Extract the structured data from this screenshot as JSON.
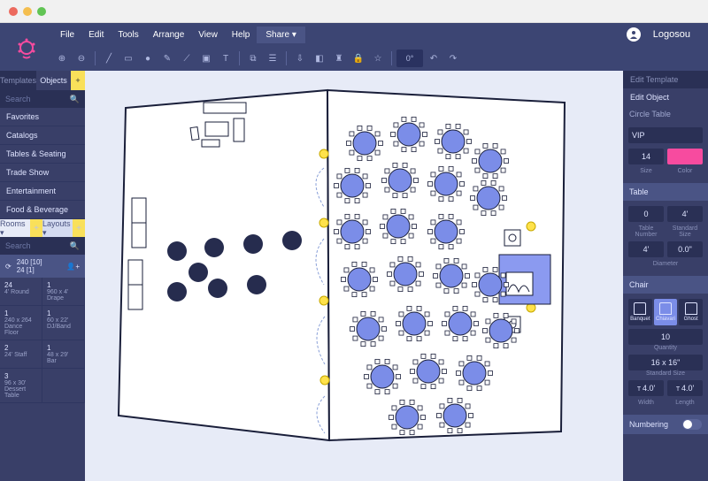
{
  "menubar": {
    "file": "File",
    "edit": "Edit",
    "tools": "Tools",
    "arrange": "Arrange",
    "view": "View",
    "help": "Help",
    "share": "Share ▾"
  },
  "user": {
    "name": "Logosou"
  },
  "toolbar": {
    "rotation": "0°"
  },
  "left": {
    "tabs": {
      "templates": "Templates",
      "objects": "Objects"
    },
    "search": "Search",
    "cats": [
      "Favorites",
      "Catalogs",
      "Tables & Seating",
      "Trade Show",
      "Entertainment",
      "Food & Beverage"
    ],
    "rooms": "Rooms ▾",
    "layouts": "Layouts ▾",
    "stats": {
      "a": "240 [10]",
      "b": "24 [1]"
    },
    "objs": [
      {
        "n": "24",
        "d": "4' Round"
      },
      {
        "n": "1",
        "d": "960 x 4' Drape"
      },
      {
        "n": "1",
        "d": "240 x 264 Dance Floor"
      },
      {
        "n": "1",
        "d": "60 x 22' DJ/Band"
      },
      {
        "n": "2",
        "d": "24' Staff"
      },
      {
        "n": "1",
        "d": "48 x 29' Bar"
      },
      {
        "n": "3",
        "d": "96 x 30' Dessert Table"
      },
      {
        "n": "",
        "d": ""
      }
    ]
  },
  "right": {
    "editTemplate": "Edit Template",
    "editObject": "Edit Object",
    "objType": "Circle Table",
    "name": "VIP",
    "size": "14",
    "sizeLbl": "Size",
    "colorLbl": "Color",
    "tableSec": "Table",
    "tableNum": "0",
    "tableNumLbl": "Table Number",
    "stdSize": "4'",
    "stdSizeLbl": "Standard Size",
    "diam1": "4'",
    "diam2": "0.0\"",
    "diamLbl": "Diameter",
    "chairSec": "Chair",
    "chairs": [
      {
        "n": "Banquet"
      },
      {
        "n": "Chiavari"
      },
      {
        "n": "Ghost"
      }
    ],
    "qty": "10",
    "qtyLbl": "Quantity",
    "chairSize": "16 x 16\"",
    "chairSizeLbl": "Standard Size",
    "w": "4.0'",
    "wLbl": "Width",
    "l": "4.0'",
    "lLbl": "Length",
    "numbering": "Numbering"
  }
}
